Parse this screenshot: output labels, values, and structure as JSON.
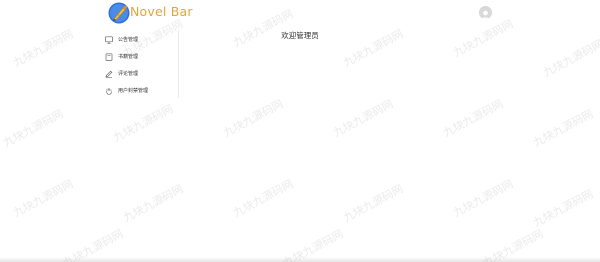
{
  "header": {
    "brand": "Novel Bar",
    "logo_icon": "quill-pen-icon",
    "avatar_icon": "user-avatar-icon"
  },
  "sidebar": {
    "items": [
      {
        "label": "公告管理",
        "icon": "monitor-icon"
      },
      {
        "label": "书籍管理",
        "icon": "book-icon"
      },
      {
        "label": "评论管理",
        "icon": "pen-icon"
      },
      {
        "label": "用户封禁管理",
        "icon": "hand-icon"
      }
    ]
  },
  "main": {
    "title": "欢迎管理员"
  },
  "watermark": {
    "text": "九块九源码网"
  },
  "colors": {
    "brand": "#e4a53a",
    "text": "#303133",
    "icon": "#606266"
  }
}
